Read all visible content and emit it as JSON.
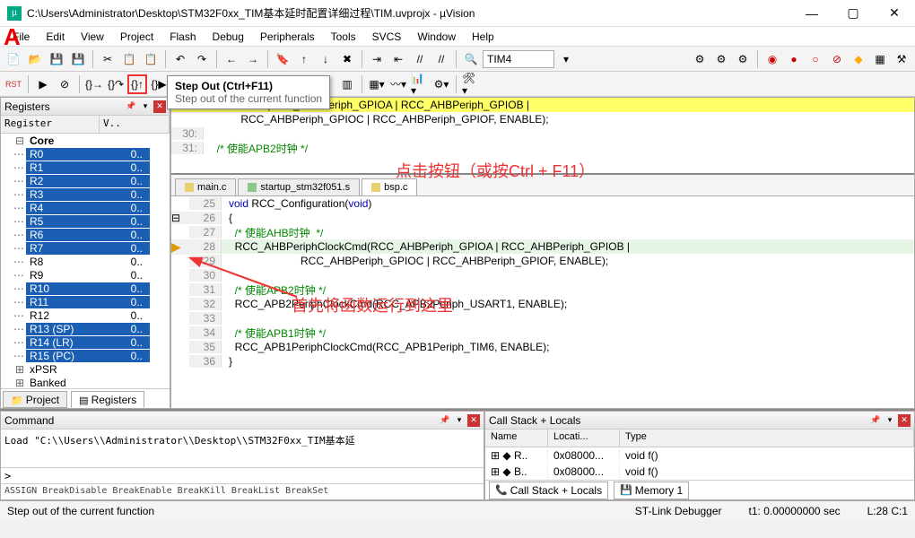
{
  "window": {
    "title": "C:\\Users\\Administrator\\Desktop\\STM32F0xx_TIM基本延时配置详细过程\\TIM.uvprojx - µVision"
  },
  "menu": [
    "File",
    "Edit",
    "View",
    "Project",
    "Flash",
    "Debug",
    "Peripherals",
    "Tools",
    "SVCS",
    "Window",
    "Help"
  ],
  "toolbar_target": "TIM4",
  "tooltip": {
    "title": "Step Out (Ctrl+F11)",
    "desc": "Step out of the current function"
  },
  "annotations": {
    "a1": "点击按钮（或按Ctrl + F11）",
    "a2": "首先将函数运行到这里",
    "letter": "A"
  },
  "registers": {
    "title": "Registers",
    "col1": "Register",
    "col2": "V..",
    "core_label": "Core",
    "rows": [
      {
        "name": "R0",
        "val": "0..",
        "sel": true
      },
      {
        "name": "R1",
        "val": "0..",
        "sel": true
      },
      {
        "name": "R2",
        "val": "0..",
        "sel": true
      },
      {
        "name": "R3",
        "val": "0..",
        "sel": true
      },
      {
        "name": "R4",
        "val": "0..",
        "sel": true
      },
      {
        "name": "R5",
        "val": "0..",
        "sel": true
      },
      {
        "name": "R6",
        "val": "0..",
        "sel": true
      },
      {
        "name": "R7",
        "val": "0..",
        "sel": true
      },
      {
        "name": "R8",
        "val": "0..",
        "sel": false
      },
      {
        "name": "R9",
        "val": "0..",
        "sel": false
      },
      {
        "name": "R10",
        "val": "0..",
        "sel": true
      },
      {
        "name": "R11",
        "val": "0..",
        "sel": true
      },
      {
        "name": "R12",
        "val": "0..",
        "sel": false
      },
      {
        "name": "R13 (SP)",
        "val": "0..",
        "sel": true
      },
      {
        "name": "R14 (LR)",
        "val": "0..",
        "sel": true
      },
      {
        "name": "R15 (PC)",
        "val": "0..",
        "sel": true
      }
    ],
    "extra": [
      "xPSR",
      "Banked"
    ],
    "tabs": {
      "project": "Project",
      "registers": "Registers"
    }
  },
  "upper_code": [
    {
      "n": "",
      "txt": "hClockCmd(RCC_AHBPeriph_GPIOA | RCC_AHBPeriph_GPIOB |",
      "hl": true
    },
    {
      "n": "",
      "txt": "          RCC_AHBPeriph_GPIOC | RCC_AHBPeriph_GPIOF, ENABLE);",
      "hl": false
    },
    {
      "n": "30:",
      "txt": "",
      "hl": false
    },
    {
      "n": "31:",
      "txt": "  /* 使能APB2时钟 */",
      "hl": false,
      "cm": true
    }
  ],
  "editor_tabs": [
    {
      "label": "main.c",
      "act": false,
      "color": "#e6d070"
    },
    {
      "label": "startup_stm32f051.s",
      "act": false,
      "color": "#8ac98a"
    },
    {
      "label": "bsp.c",
      "act": true,
      "color": "#e6d070"
    }
  ],
  "code": [
    {
      "n": 25,
      "txt": "void RCC_Configuration(void)",
      "kind": "decl"
    },
    {
      "n": 26,
      "txt": "{",
      "fold": true
    },
    {
      "n": 27,
      "txt": "  /* 使能AHB时钟  */",
      "kind": "cm"
    },
    {
      "n": 28,
      "txt": "  RCC_AHBPeriphClockCmd(RCC_AHBPeriph_GPIOA | RCC_AHBPeriph_GPIOB |",
      "cur": true
    },
    {
      "n": 29,
      "txt": "                        RCC_AHBPeriph_GPIOC | RCC_AHBPeriph_GPIOF, ENABLE);"
    },
    {
      "n": 30,
      "txt": ""
    },
    {
      "n": 31,
      "txt": "  /* 使能APB2时钟 */",
      "kind": "cm"
    },
    {
      "n": 32,
      "txt": "  RCC_APB2PeriphClockCmd(RCC_APB2Periph_USART1, ENABLE);"
    },
    {
      "n": 33,
      "txt": ""
    },
    {
      "n": 34,
      "txt": "  /* 使能APB1时钟 */",
      "kind": "cm"
    },
    {
      "n": 35,
      "txt": "  RCC_APB1PeriphClockCmd(RCC_APB1Periph_TIM6, ENABLE);"
    },
    {
      "n": 36,
      "txt": "}"
    }
  ],
  "command": {
    "title": "Command",
    "text": "Load \"C:\\\\Users\\\\Administrator\\\\Desktop\\\\STM32F0xx_TIM基本延",
    "prompt": ">",
    "assign": "ASSIGN BreakDisable BreakEnable BreakKill BreakList BreakSet"
  },
  "callstack": {
    "title": "Call Stack + Locals",
    "cols": [
      "Name",
      "Locati...",
      "Type"
    ],
    "rows": [
      {
        "name": "R..",
        "loc": "0x08000...",
        "type": "void f()"
      },
      {
        "name": "B..",
        "loc": "0x08000...",
        "type": "void f()"
      }
    ],
    "tabs": {
      "cs": "Call Stack + Locals",
      "mem": "Memory 1"
    }
  },
  "status": {
    "left": "Step out of the current function",
    "mid": "ST-Link Debugger",
    "t1": "t1: 0.00000000 sec",
    "lc": "L:28 C:1"
  }
}
